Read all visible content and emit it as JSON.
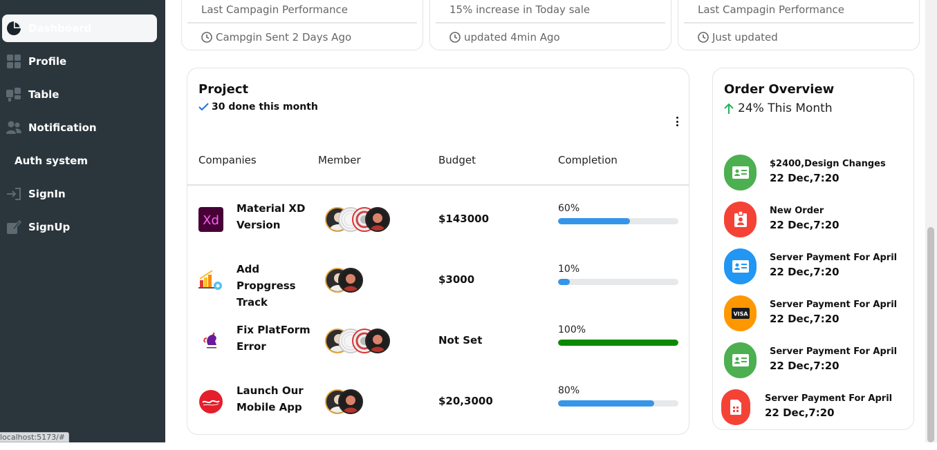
{
  "sidebar": {
    "items": [
      {
        "label": "Dashboard",
        "icon": "pie-chart-icon",
        "active": true
      },
      {
        "label": "Profile",
        "icon": "grid-icon"
      },
      {
        "label": "Table",
        "icon": "table-icon"
      },
      {
        "label": "Notification",
        "icon": "users-icon"
      }
    ],
    "heading": "Auth system",
    "auth_items": [
      {
        "label": "SignIn",
        "icon": "sign-in-icon"
      },
      {
        "label": "SignUp",
        "icon": "sign-up-icon"
      }
    ]
  },
  "status_url": "localhost:5173/#",
  "stat_cards": [
    {
      "subtitle": "Last Campagin Performance",
      "footer": "Campgin Sent 2 Days Ago"
    },
    {
      "subtitle": "15% increase in Today sale",
      "footer": "updated 4min Ago"
    },
    {
      "subtitle": "Last Campagin Performance",
      "footer": "Just updated"
    }
  ],
  "project": {
    "title": "Project",
    "subtitle": "30 done this month",
    "columns": [
      "Companies",
      "Member",
      "Budget",
      "Completion"
    ],
    "rows": [
      {
        "name": "Material XD Version",
        "logo": "xd-logo",
        "members": 4,
        "budget": "$143000",
        "completion_label": "60%",
        "completion": 60,
        "bar_color": "#3595e8"
      },
      {
        "name": "Add Propgress Track",
        "logo": "chart-gear-logo",
        "members": 2,
        "budget": "$3000",
        "completion_label": "10%",
        "completion": 10,
        "bar_color": "#3595e8"
      },
      {
        "name": "Fix PlatForm Error",
        "logo": "rooster-logo",
        "members": 4,
        "budget": "Not Set",
        "completion_label": "100%",
        "completion": 100,
        "bar_color": "#0b8a00"
      },
      {
        "name": "Launch Our Mobile App",
        "logo": "coca-cola-logo",
        "members": 2,
        "budget": "$20,3000",
        "completion_label": "80%",
        "completion": 80,
        "bar_color": "#3595e8"
      }
    ]
  },
  "orders": {
    "title": "Order Overview",
    "subtitle": "24% This Month",
    "items": [
      {
        "title": "$2400,Design Changes",
        "date": "22 Dec,7:20",
        "color": "#4caf50",
        "icon": "id-card-icon"
      },
      {
        "title": "New Order",
        "date": "22 Dec,7:20",
        "color": "#f44336",
        "icon": "badge-icon"
      },
      {
        "title": "Server Payment For April",
        "date": "22 Dec,7:20",
        "color": "#2196f3",
        "icon": "id-card-icon"
      },
      {
        "title": "Server Payment For April",
        "date": "22 Dec,7:20",
        "color": "#ff9800",
        "icon": "visa-icon"
      },
      {
        "title": "Server Payment For April",
        "date": "22 Dec,7:20",
        "color": "#4caf50",
        "icon": "id-card-icon"
      },
      {
        "title": "Server Payment For April",
        "date": "22 Dec,7:20",
        "color": "#f44336",
        "icon": "sim-card-icon"
      }
    ]
  }
}
